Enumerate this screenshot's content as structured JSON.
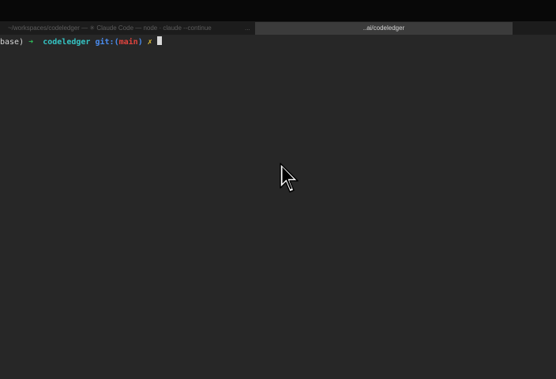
{
  "window": {
    "tabs": [
      {
        "title": "~/workspaces/codeledger — ✳ Claude Code — node · claude --continue",
        "active": false
      },
      {
        "title": "..ai/codeledger",
        "active": true
      }
    ],
    "overflow_label": "..."
  },
  "terminal": {
    "prompt": {
      "env": "base)",
      "arrow": "➜",
      "directory": "codeledger",
      "git_label": "git:",
      "branch_open": "(",
      "branch": "main",
      "branch_close": ")",
      "dirty_marker": "✗"
    },
    "input_value": ""
  },
  "colors": {
    "background": "#272727",
    "arrow": "#2fbf5c",
    "directory": "#35c4c4",
    "git": "#4a8cf0",
    "branch": "#e0443e",
    "dirty": "#e1c039"
  },
  "icons": {
    "pointer": "mouse-pointer-icon"
  }
}
